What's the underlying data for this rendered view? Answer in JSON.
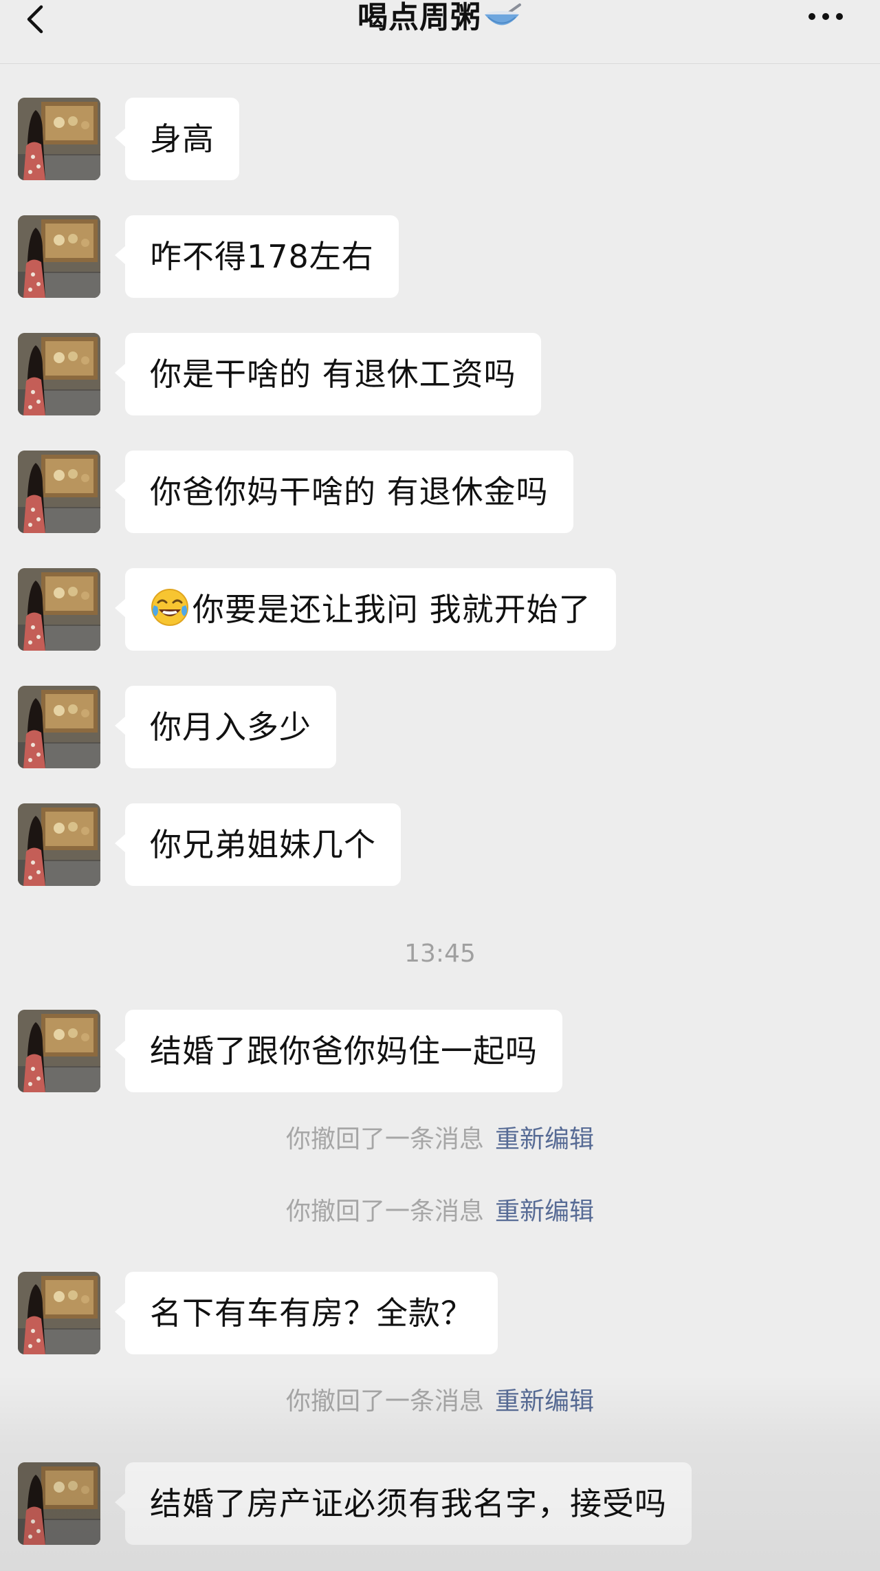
{
  "header": {
    "title": "喝点周粥",
    "title_emoji": "bowl-with-spoon-icon",
    "back_icon": "chevron-left-icon",
    "more_icon": "ellipsis-icon"
  },
  "messages": [
    {
      "text": "身高"
    },
    {
      "text": "咋不得178左右"
    },
    {
      "text": "你是干啥的 有退休工资吗"
    },
    {
      "text": "你爸你妈干啥的 有退休金吗"
    },
    {
      "emoji": "tears-of-joy-emoji",
      "text": "你要是还让我问 我就开始了"
    },
    {
      "text": "你月入多少"
    },
    {
      "text": "你兄弟姐妹几个"
    },
    {
      "text": "结婚了跟你爸你妈住一起吗"
    },
    {
      "text": "名下有车有房？全款？"
    },
    {
      "text": "结婚了房产证必须有我名字，接受吗"
    }
  ],
  "timestamp": "13:45",
  "recall_notices": [
    {
      "text": "你撤回了一条消息",
      "action": "重新编辑"
    },
    {
      "text": "你撤回了一条消息",
      "action": "重新编辑"
    },
    {
      "text": "你撤回了一条消息",
      "action": "重新编辑"
    }
  ],
  "colors": {
    "background": "#ededed",
    "bubble": "#ffffff",
    "link": "#576b95",
    "system_text": "#a6a6a6"
  }
}
